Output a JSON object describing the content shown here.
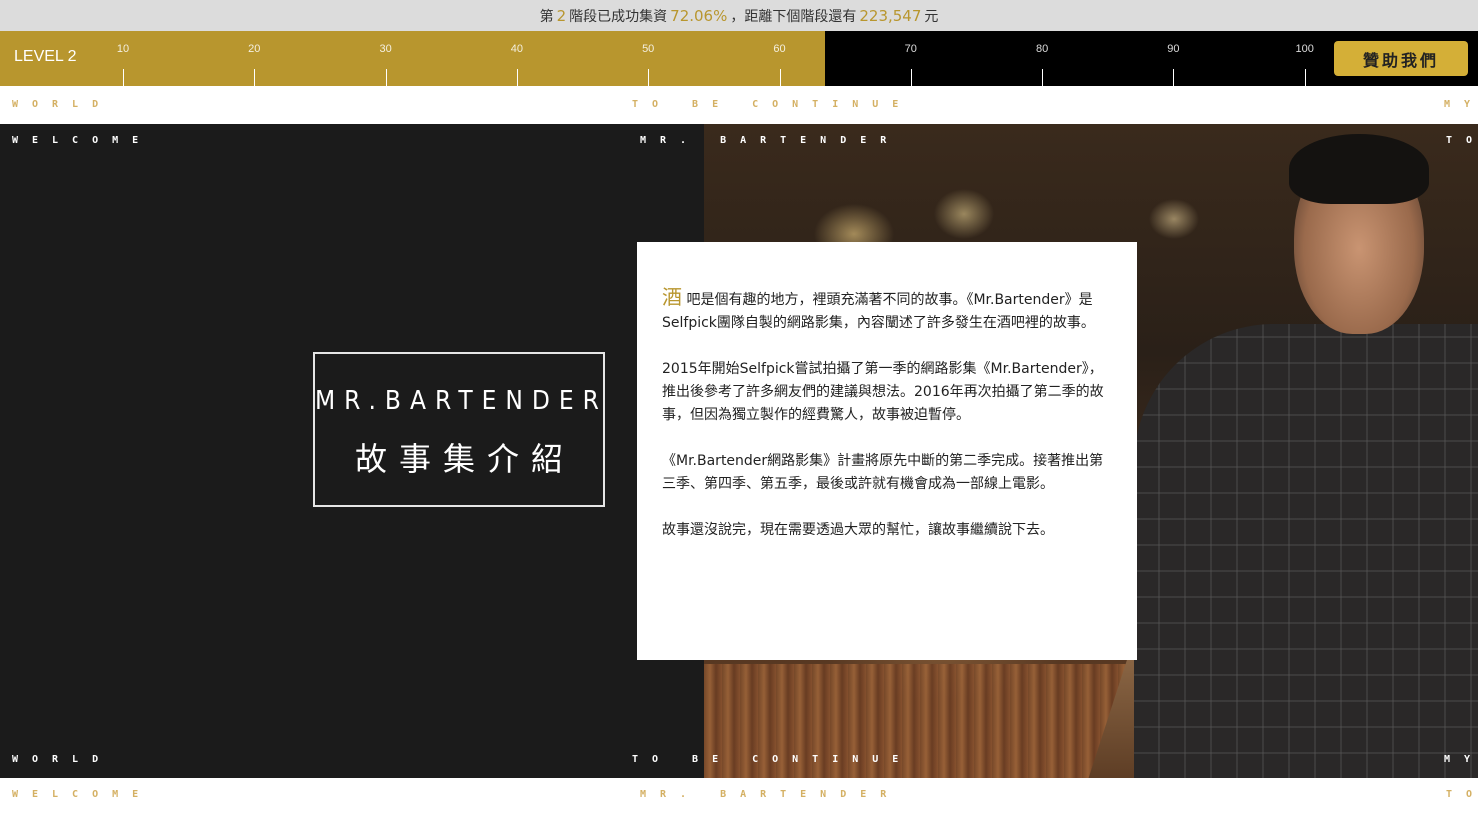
{
  "status": {
    "prefix": "第",
    "stage": "2",
    "mid": "階段已成功集資",
    "percent": "72.06%",
    "sep": "，距離下個階段還有",
    "remaining": "223,547",
    "unit": "元"
  },
  "progress": {
    "level_label": "LEVEL 2",
    "percent_value": 63.5,
    "ticks": [
      "10",
      "20",
      "30",
      "40",
      "50",
      "60",
      "70",
      "80",
      "90",
      "100"
    ],
    "sponsor_button": "贊助我們",
    "fill_color": "#b8962e"
  },
  "marquee": {
    "world": "WORLD",
    "to_be_continue": "TO BE CONTINUE",
    "my": "MY",
    "welcome": "WELCOME",
    "mr_bartender": "MR. BARTENDER",
    "to": "TO"
  },
  "hero": {
    "title_en": "MR.BARTENDER",
    "title_zh": "故事集介紹"
  },
  "story": {
    "drop_char": "酒",
    "p1": "吧是個有趣的地方，裡頭充滿著不同的故事。《Mr.Bartender》是Selfpick團隊自製的網路影集，內容闡述了許多發生在酒吧裡的故事。",
    "p2": "2015年開始Selfpick嘗試拍攝了第一季的網路影集《Mr.Bartender》，推出後參考了許多網友們的建議與想法。2016年再次拍攝了第二季的故事，但因為獨立製作的經費驚人，故事被迫暫停。",
    "p3": "《Mr.Bartender網路影集》計畫將原先中斷的第二季完成。接著推出第三季、第四季、第五季，最後或許就有機會成為一部線上電影。",
    "p4": "故事還沒說完，現在需要透過大眾的幫忙，讓故事繼續說下去。"
  },
  "colors": {
    "accent_gold": "#b8962e",
    "button_gold": "#d4af37",
    "marquee_gold": "#d4b063",
    "hero_dark": "#1b1b1b"
  }
}
